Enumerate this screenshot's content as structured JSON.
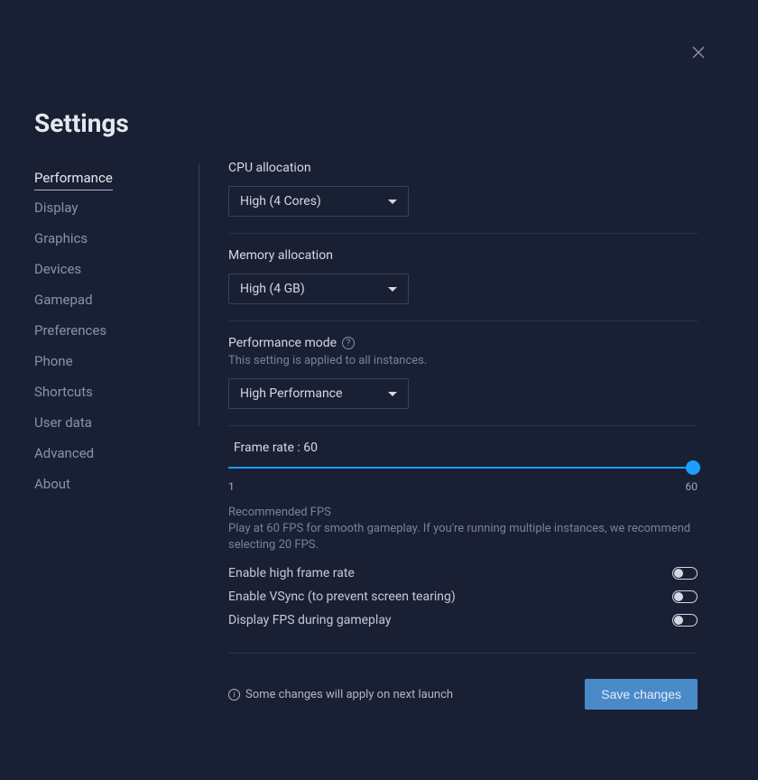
{
  "title": "Settings",
  "sidebar": {
    "items": [
      {
        "label": "Performance",
        "active": true
      },
      {
        "label": "Display"
      },
      {
        "label": "Graphics"
      },
      {
        "label": "Devices"
      },
      {
        "label": "Gamepad"
      },
      {
        "label": "Preferences"
      },
      {
        "label": "Phone"
      },
      {
        "label": "Shortcuts"
      },
      {
        "label": "User data"
      },
      {
        "label": "Advanced"
      },
      {
        "label": "About"
      }
    ]
  },
  "cpu": {
    "label": "CPU allocation",
    "value": "High (4 Cores)"
  },
  "memory": {
    "label": "Memory allocation",
    "value": "High (4 GB)"
  },
  "perfmode": {
    "label": "Performance mode",
    "sublabel": "This setting is applied to all instances.",
    "value": "High Performance"
  },
  "framerate": {
    "label": "Frame rate : 60",
    "min": "1",
    "max": "60",
    "rec_title": "Recommended FPS",
    "rec_body": "Play at 60 FPS for smooth gameplay. If you're running multiple instances, we recommend selecting 20 FPS."
  },
  "toggles": [
    {
      "label": "Enable high frame rate"
    },
    {
      "label": "Enable VSync (to prevent screen tearing)"
    },
    {
      "label": "Display FPS during gameplay"
    }
  ],
  "footer": {
    "note": "Some changes will apply on next launch",
    "save": "Save changes"
  }
}
